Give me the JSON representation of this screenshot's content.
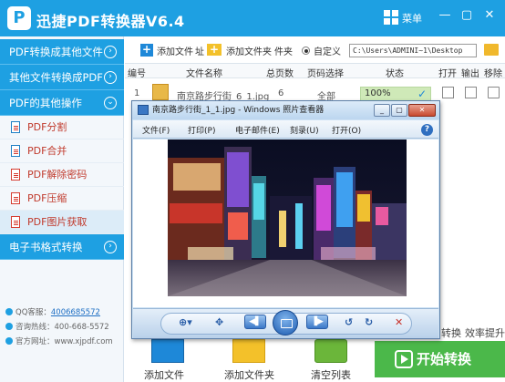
{
  "app": {
    "title": "迅捷PDF转换器V6.4",
    "logo": "P",
    "menu_label": "菜单"
  },
  "sidebar": {
    "categories": [
      {
        "label": "PDF转换成其他文件"
      },
      {
        "label": "其他文件转换成PDF"
      },
      {
        "label": "PDF的其他操作"
      }
    ],
    "items": [
      {
        "label": "PDF分割"
      },
      {
        "label": "PDF合并"
      },
      {
        "label": "PDF解除密码"
      },
      {
        "label": "PDF压缩"
      },
      {
        "label": "PDF图片获取"
      }
    ],
    "ebook_category": {
      "label": "电子书格式转换"
    },
    "contact": {
      "qq_label": "QQ客服：",
      "qq_value": "4006685572",
      "phone": "咨询热线：400-668-5572",
      "site": "官方网址：www.xjpdf.com"
    }
  },
  "toolbar": {
    "add_file": "添加文件",
    "add_file_trail": "址",
    "add_folder": "添加文件夹",
    "add_folder_trail": "件夹",
    "custom_label": "自定义",
    "path_value": "C:\\Users\\ADMINI~1\\Desktop"
  },
  "table": {
    "headers": {
      "index": "编号",
      "name": "文件名称",
      "pages": "总页数",
      "range": "页码选择",
      "status": "状态",
      "open": "打开",
      "output": "输出",
      "remove": "移除"
    },
    "rows": [
      {
        "index": "1",
        "name": "南京路步行街_6_1.jpg",
        "pages": "6",
        "range": "全部",
        "progress": "100%",
        "progress_value": 1.0
      }
    ]
  },
  "viewer": {
    "title": "南京路步行街_1_1.jpg - Windows 照片查看器",
    "menu": [
      "文件(F)",
      "打印(P)",
      "电子邮件(E)",
      "刻录(U)",
      "打开(O)"
    ],
    "help": "?",
    "controls": {
      "zoom": "⊕▾",
      "fit": "✥",
      "prev": "◀▌",
      "next": "▐▶",
      "rotate_left": "↺",
      "rotate_right": "↻",
      "delete": "✕"
    }
  },
  "bottom": {
    "add_file": "添加文件",
    "add_folder": "添加文件夹",
    "clear_list": "清空列表",
    "start": "开始转换",
    "partial_left": "转换",
    "partial_right": "效率提升"
  },
  "colors": {
    "primary": "#1ea0e2",
    "accent_green": "#4bb84a",
    "folder_yellow": "#f3c12a"
  }
}
